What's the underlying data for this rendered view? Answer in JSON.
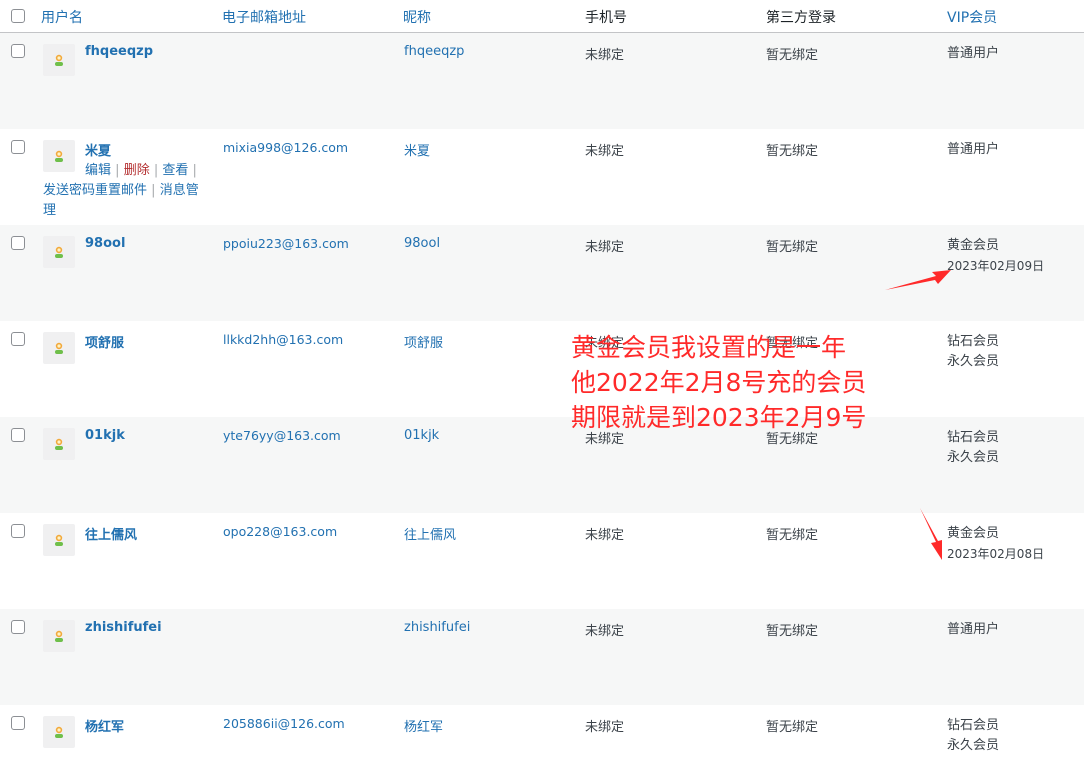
{
  "header": {
    "username": "用户名",
    "email": "电子邮箱地址",
    "nickname": "昵称",
    "phone": "手机号",
    "third_party": "第三方登录",
    "vip": "VIP会员"
  },
  "row_actions": {
    "edit": "编辑",
    "delete": "删除",
    "view": "查看",
    "send_reset": "发送密码重置邮件",
    "messages": "消息管理",
    "sep": "|"
  },
  "rows": [
    {
      "username": "fhqeeqzp",
      "email": "",
      "nickname": "fhqeeqzp",
      "phone": "未绑定",
      "third": "暂无绑定",
      "vip": "普通用户",
      "vip2": ""
    },
    {
      "username": "米夏",
      "email": "mixia998@126.com",
      "nickname": "米夏",
      "phone": "未绑定",
      "third": "暂无绑定",
      "vip": "普通用户",
      "vip2": ""
    },
    {
      "username": "98ool",
      "email": "ppoiu223@163.com",
      "nickname": "98ool",
      "phone": "未绑定",
      "third": "暂无绑定",
      "vip": "黄金会员",
      "vip2": "2023年02月09日"
    },
    {
      "username": "项舒服",
      "email": "llkkd2hh@163.com",
      "nickname": "项舒服",
      "phone": "未绑定",
      "third": "暂无绑定",
      "vip": "钻石会员",
      "vip2": "永久会员"
    },
    {
      "username": "01kjk",
      "email": "yte76yy@163.com",
      "nickname": "01kjk",
      "phone": "未绑定",
      "third": "暂无绑定",
      "vip": "钻石会员",
      "vip2": "永久会员"
    },
    {
      "username": "往上儒风",
      "email": "opo228@163.com",
      "nickname": "往上儒风",
      "phone": "未绑定",
      "third": "暂无绑定",
      "vip": "黄金会员",
      "vip2": "2023年02月08日"
    },
    {
      "username": "zhishifufei",
      "email": "",
      "nickname": "zhishifufei",
      "phone": "未绑定",
      "third": "暂无绑定",
      "vip": "普通用户",
      "vip2": ""
    },
    {
      "username": "杨红军",
      "email": "205886ii@126.com",
      "nickname": "杨红军",
      "phone": "未绑定",
      "third": "暂无绑定",
      "vip": "钻石会员",
      "vip2": "永久会员"
    }
  ],
  "annotation": {
    "line1": "黄金会员我设置的是一年",
    "line2": "他2022年2月8号充的会员",
    "line3": "期限就是到2023年2月9号",
    "color": "#ff2a2a"
  }
}
